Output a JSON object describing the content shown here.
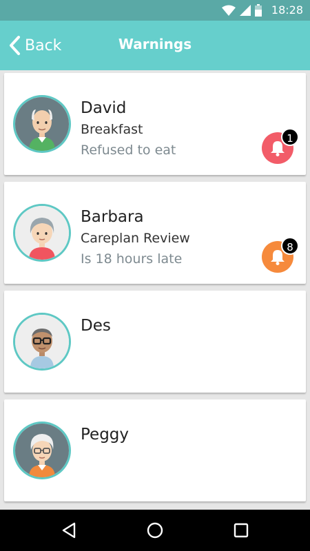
{
  "status_bar": {
    "time": "18:28"
  },
  "app_bar": {
    "back_label": "Back",
    "title": "Warnings"
  },
  "residents": [
    {
      "name": "David",
      "line1": "Breakfast",
      "line2": "Refused to eat",
      "alert_count": "1",
      "alert_color": "#f25c68"
    },
    {
      "name": "Barbara",
      "line1": "Careplan Review",
      "line2": "Is 18 hours late",
      "alert_count": "8",
      "alert_color": "#f68a3c"
    },
    {
      "name": "Des"
    },
    {
      "name": "Peggy"
    }
  ],
  "colors": {
    "app_bar": "#66cfcc",
    "status_bar": "#5aa9a6",
    "avatar_ring": "#5ec8c4"
  }
}
